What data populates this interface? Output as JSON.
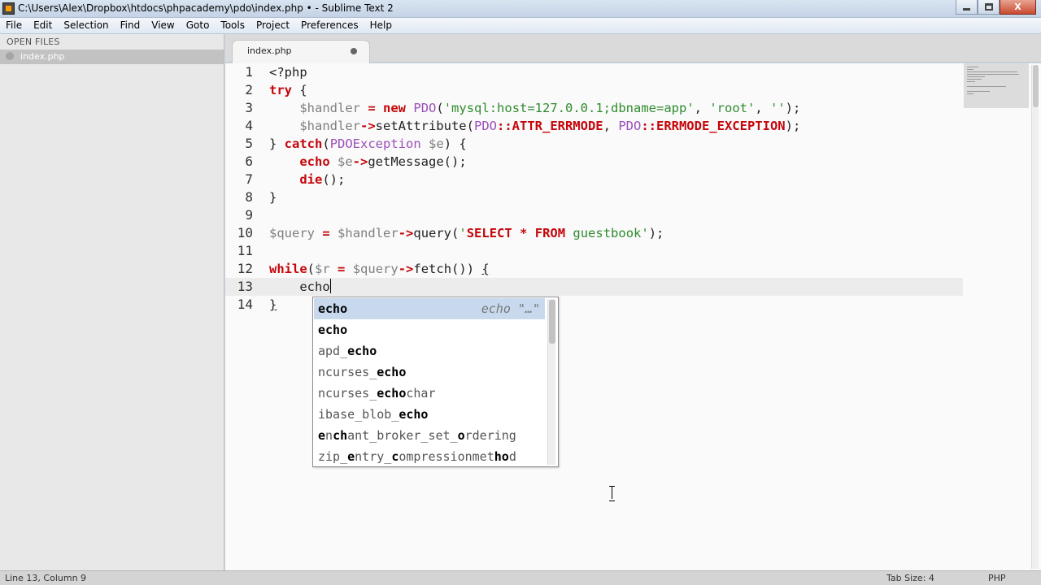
{
  "window": {
    "title": "C:\\Users\\Alex\\Dropbox\\htdocs\\phpacademy\\pdo\\index.php • - Sublime Text 2",
    "close_symbol": "X"
  },
  "menu": [
    "File",
    "Edit",
    "Selection",
    "Find",
    "View",
    "Goto",
    "Tools",
    "Project",
    "Preferences",
    "Help"
  ],
  "sidebar": {
    "header": "OPEN FILES",
    "files": [
      {
        "name": "index.php"
      }
    ]
  },
  "tabs": [
    {
      "label": "index.php",
      "modified": true
    }
  ],
  "editor": {
    "line_numbers": [
      "1",
      "2",
      "3",
      "4",
      "5",
      "6",
      "7",
      "8",
      "9",
      "10",
      "11",
      "12",
      "13",
      "14"
    ],
    "current_line": 13
  },
  "autocomplete": {
    "hint_keyword": "echo",
    "hint_string": "\"…\"",
    "items": [
      {
        "pre": "",
        "match": "echo",
        "post": ""
      },
      {
        "pre": "",
        "match": "echo",
        "post": ""
      },
      {
        "pre": "apd_",
        "match": "echo",
        "post": ""
      },
      {
        "pre": "ncurses_",
        "match": "echo",
        "post": ""
      },
      {
        "pre": "ncurses_",
        "match": "echo",
        "post": "char"
      },
      {
        "pre": "ibase_blob_",
        "match": "echo",
        "post": ""
      },
      {
        "pre": "",
        "match": "e",
        "post": "n",
        "match2": "ch",
        "post2": "ant_broker_set_",
        "match3": "o",
        "post3": "rdering"
      },
      {
        "pre": "zip_",
        "match": "e",
        "post": "ntry_",
        "match2": "c",
        "post2": "ompressionmet",
        "match3": "ho",
        "post3": "d"
      }
    ]
  },
  "status": {
    "position": "Line 13, Column 9",
    "tab_size": "Tab Size: 4",
    "syntax": "PHP"
  }
}
